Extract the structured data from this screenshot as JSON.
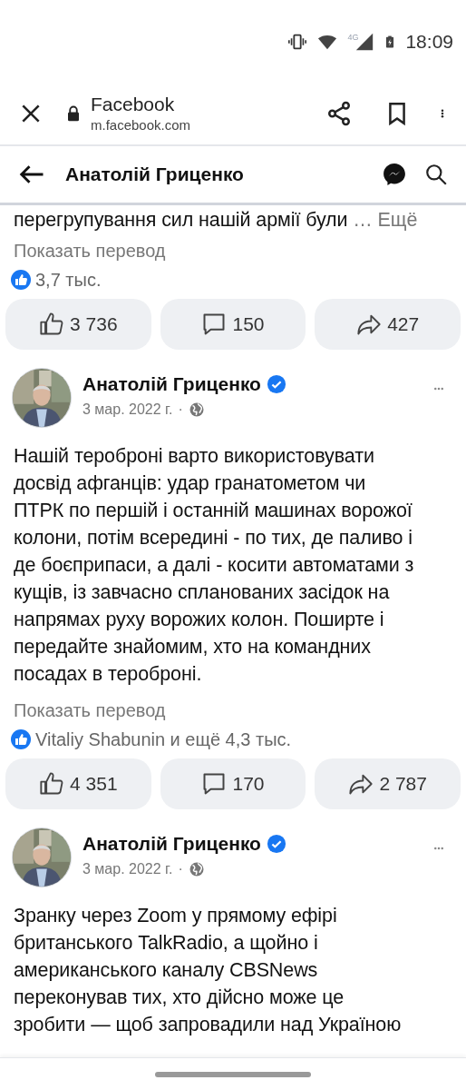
{
  "status_bar": {
    "network": "4G",
    "time": "18:09"
  },
  "browser": {
    "title": "Facebook",
    "url": "m.facebook.com"
  },
  "page_header": {
    "title": "Анатолій Гриценко"
  },
  "posts": [
    {
      "text": "перегрупування сил нашій армії були",
      "more": "… Ещё",
      "translate": "Показать перевод",
      "reactions": "3,7 тыс.",
      "actions": [
        {
          "kind": "like",
          "count": "3 736"
        },
        {
          "kind": "comment",
          "count": "150"
        },
        {
          "kind": "share",
          "count": "427"
        }
      ]
    },
    {
      "author": "Анатолій Гриценко",
      "verified": true,
      "date": "3 мар. 2022 г.",
      "separator": "·",
      "text_lines": [
        "Нашій тероброні варто використовувати",
        "досвід афганців: удар гранатометом чи",
        "ПТРК по першій і останній машинах ворожої",
        "колони, потім всередині - по тих, де паливо і",
        "де боєприпаси, а далі - косити автоматами з",
        "кущів, із завчасно спланованих засідок на",
        "напрямах руху ворожих колон. Поширте і",
        "передайте знайомим, хто на командних",
        "посадах в тероброні."
      ],
      "translate": "Показать перевод",
      "reactions": "Vitaliy Shabunin и ещё 4,3 тыс.",
      "actions": [
        {
          "kind": "like",
          "count": "4 351"
        },
        {
          "kind": "comment",
          "count": "170"
        },
        {
          "kind": "share",
          "count": "2 787"
        }
      ]
    },
    {
      "author": "Анатолій Гриценко",
      "verified": true,
      "date": "3 мар. 2022 г.",
      "separator": "·",
      "text_lines": [
        "Зранку через Zoom у прямому ефірі",
        "британського TalkRadio, а щойно і",
        "американського каналу CBSNews",
        "переконував тих, хто дійсно може це",
        "зробити — щоб запровадили над Україною"
      ]
    }
  ]
}
